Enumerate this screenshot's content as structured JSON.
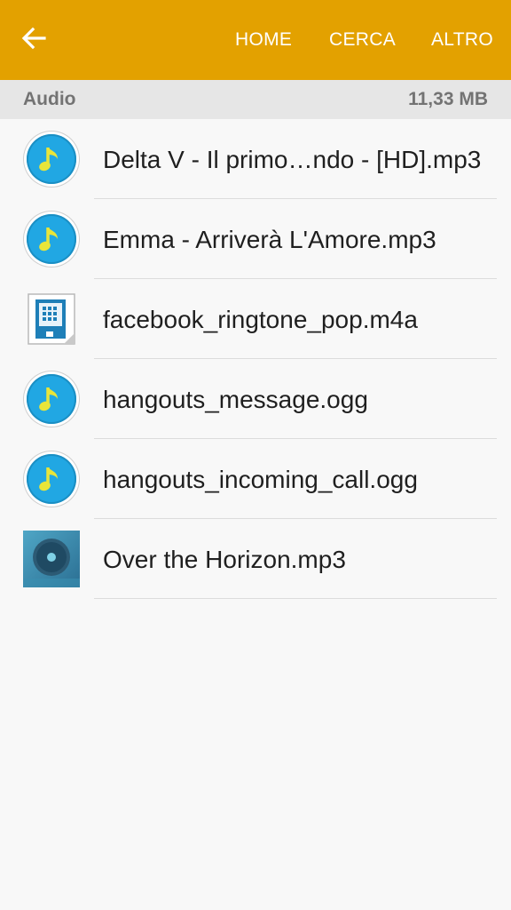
{
  "appbar": {
    "back_icon": "arrow-left-icon",
    "actions": [
      "HOME",
      "CERCA",
      "ALTRO"
    ],
    "color": "#e3a100"
  },
  "section": {
    "title": "Audio",
    "size": "11,33 MB"
  },
  "files": [
    {
      "name": "Delta V - Il primo…ndo - [HD].mp3",
      "icon": "music-note-icon"
    },
    {
      "name": "Emma - Arriverà L'Amore.mp3",
      "icon": "music-note-icon"
    },
    {
      "name": "facebook_ringtone_pop.m4a",
      "icon": "audio-file-icon"
    },
    {
      "name": "hangouts_message.ogg",
      "icon": "music-note-icon"
    },
    {
      "name": "hangouts_incoming_call.ogg",
      "icon": "music-note-icon"
    },
    {
      "name": "Over the Horizon.mp3",
      "icon": "album-art-thumbnail"
    }
  ]
}
